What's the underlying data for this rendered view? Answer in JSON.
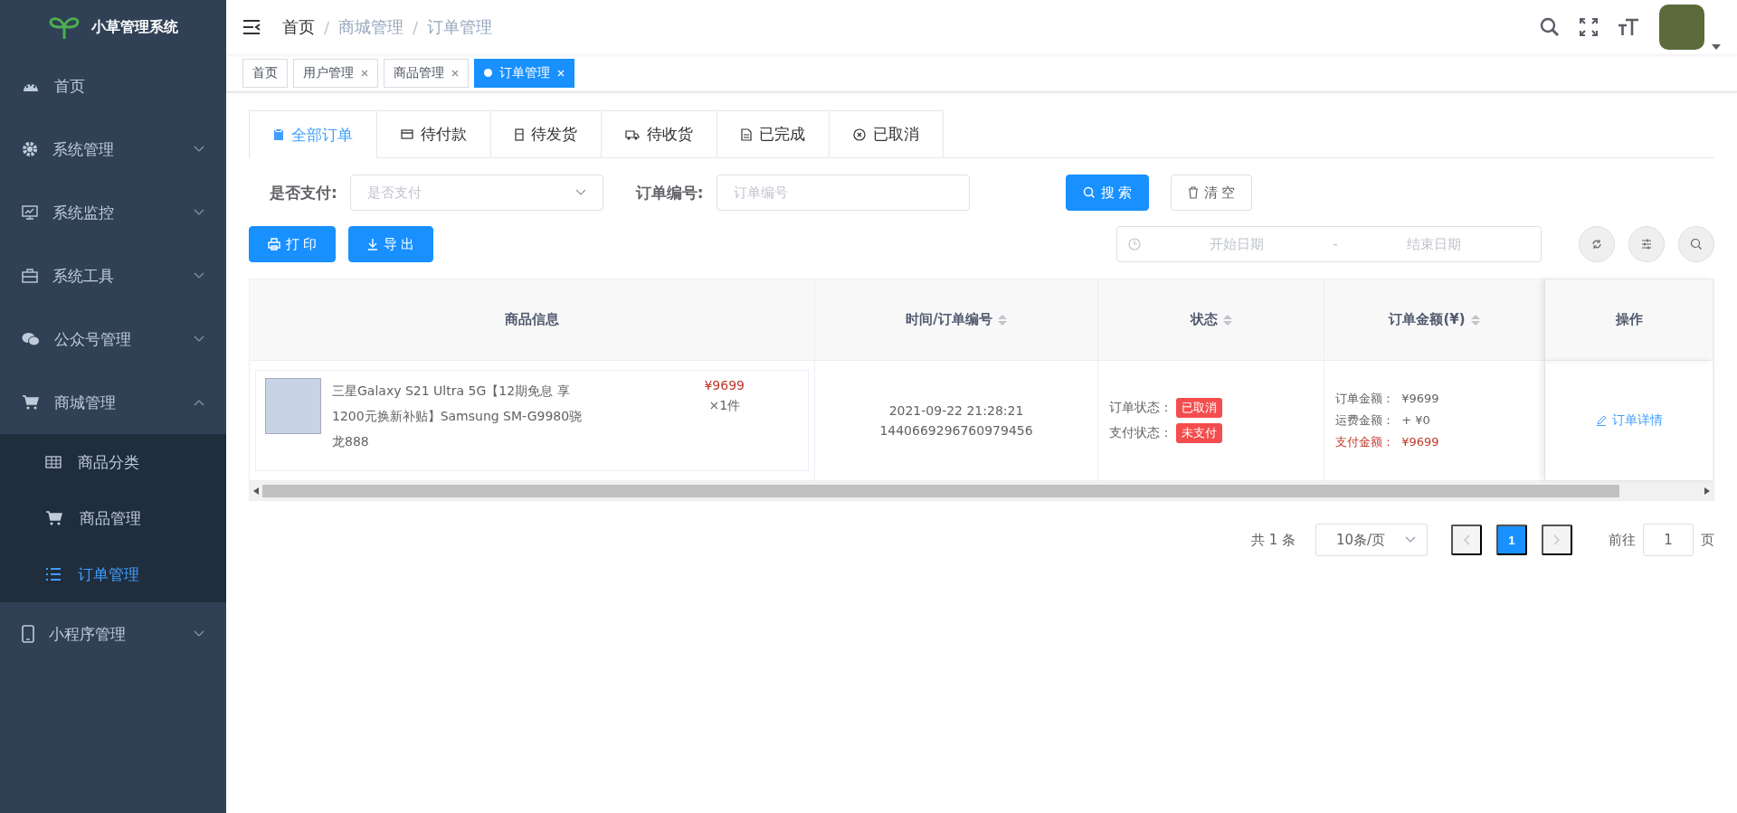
{
  "sidebar": {
    "logo_text": "小草管理系统",
    "items": [
      {
        "label": "首页",
        "kind": "link"
      },
      {
        "label": "系统管理",
        "kind": "submenu",
        "expanded": false
      },
      {
        "label": "系统监控",
        "kind": "submenu",
        "expanded": false
      },
      {
        "label": "系统工具",
        "kind": "submenu",
        "expanded": false
      },
      {
        "label": "公众号管理",
        "kind": "submenu",
        "expanded": false
      },
      {
        "label": "商城管理",
        "kind": "submenu",
        "expanded": true,
        "children": [
          {
            "label": "商品分类",
            "selected": false
          },
          {
            "label": "商品管理",
            "selected": false
          },
          {
            "label": "订单管理",
            "selected": true
          }
        ]
      },
      {
        "label": "小程序管理",
        "kind": "submenu",
        "expanded": false
      }
    ]
  },
  "breadcrumb": [
    "首页",
    "商城管理",
    "订单管理"
  ],
  "breadcrumb_separators": [
    "/",
    "/"
  ],
  "tags": [
    {
      "label": "首页",
      "closable": false,
      "selected": false
    },
    {
      "label": "用户管理",
      "closable": true,
      "selected": false
    },
    {
      "label": "商品管理",
      "closable": true,
      "selected": false
    },
    {
      "label": "订单管理",
      "closable": true,
      "selected": true
    }
  ],
  "order_tabs": [
    {
      "label": "全部订单",
      "selected": true
    },
    {
      "label": "待付款",
      "selected": false
    },
    {
      "label": "待发货",
      "selected": false
    },
    {
      "label": "待收货",
      "selected": false
    },
    {
      "label": "已完成",
      "selected": false
    },
    {
      "label": "已取消",
      "selected": false
    }
  ],
  "filters": [
    {
      "label": "是否支付:",
      "kind": "select",
      "placeholder": "是否支付"
    },
    {
      "label": "订单编号:",
      "kind": "input",
      "placeholder": "订单编号"
    }
  ],
  "search_buttons": [
    {
      "label": "搜 索",
      "kind": "primary"
    },
    {
      "label": "清 空",
      "kind": "plain"
    }
  ],
  "action_buttons": [
    "打 印",
    "导 出"
  ],
  "date_range": {
    "start_placeholder": "开始日期",
    "separator": "-",
    "end_placeholder": "结束日期"
  },
  "table": {
    "columns": [
      {
        "title": "商品信息",
        "sortable": false
      },
      {
        "title": "时间/订单编号",
        "sortable": true
      },
      {
        "title": "状态",
        "sortable": true
      },
      {
        "title": "订单金额(¥)",
        "sortable": true
      },
      {
        "title": "操作",
        "sortable": false
      }
    ],
    "rows": [
      {
        "product": {
          "title": "三星Galaxy S21 Ultra 5G【12期免息 享1200元换新补贴】Samsung SM-G9980骁龙888",
          "price": "¥9699",
          "quantity": "×1件"
        },
        "time": "2021-09-22 21:28:21",
        "order_no": "1440669296760979456",
        "statuses": [
          {
            "label": "订单状态：",
            "value": "已取消"
          },
          {
            "label": "支付状态：",
            "value": "未支付"
          }
        ],
        "amounts": [
          {
            "label": "订单金额：",
            "value": "¥9699",
            "kind": "normal"
          },
          {
            "label": "运费金额：",
            "value": "+ ¥0",
            "kind": "normal"
          },
          {
            "label": "支付金额：",
            "value": "¥9699",
            "kind": "total"
          }
        ],
        "action": "订单详情"
      }
    ]
  },
  "pagination": {
    "total": "共 1 条",
    "page_size": "10条/页",
    "prev_disabled": true,
    "next_disabled": true,
    "pages": [
      {
        "label": "1",
        "selected": true
      }
    ],
    "goto_label": "前往",
    "goto_value": "1",
    "goto_suffix": "页"
  }
}
